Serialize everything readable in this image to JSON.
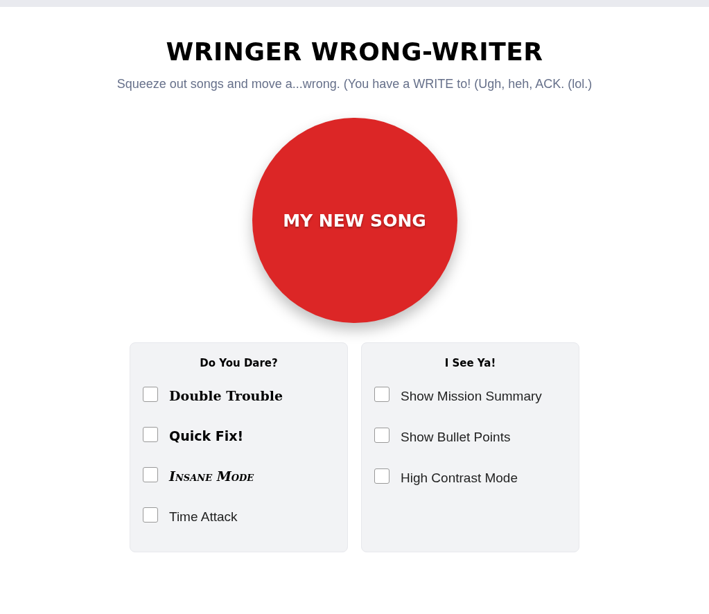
{
  "title": "WRINGER WRONG-WRITER",
  "subtitle": "Squeeze out songs and move a...wrong. (You have a WRITE to! (Ugh, heh, ACK. (lol.)",
  "main_button": "MY NEW SONG",
  "panels": [
    {
      "heading": "Do You Dare?",
      "options": [
        {
          "label": "Double Trouble",
          "kind": "serif",
          "checked": false
        },
        {
          "label": "Quick Fix!",
          "kind": "bold",
          "checked": false
        },
        {
          "label": "Insane Mode",
          "kind": "script",
          "checked": false
        },
        {
          "label": "Time Attack",
          "kind": "plain",
          "checked": false
        }
      ]
    },
    {
      "heading": "I See Ya!",
      "options": [
        {
          "label": "Show Mission Summary",
          "kind": "plain",
          "checked": false
        },
        {
          "label": "Show Bullet Points",
          "kind": "plain",
          "checked": false
        },
        {
          "label": "High Contrast Mode",
          "kind": "plain",
          "checked": false
        }
      ]
    }
  ]
}
